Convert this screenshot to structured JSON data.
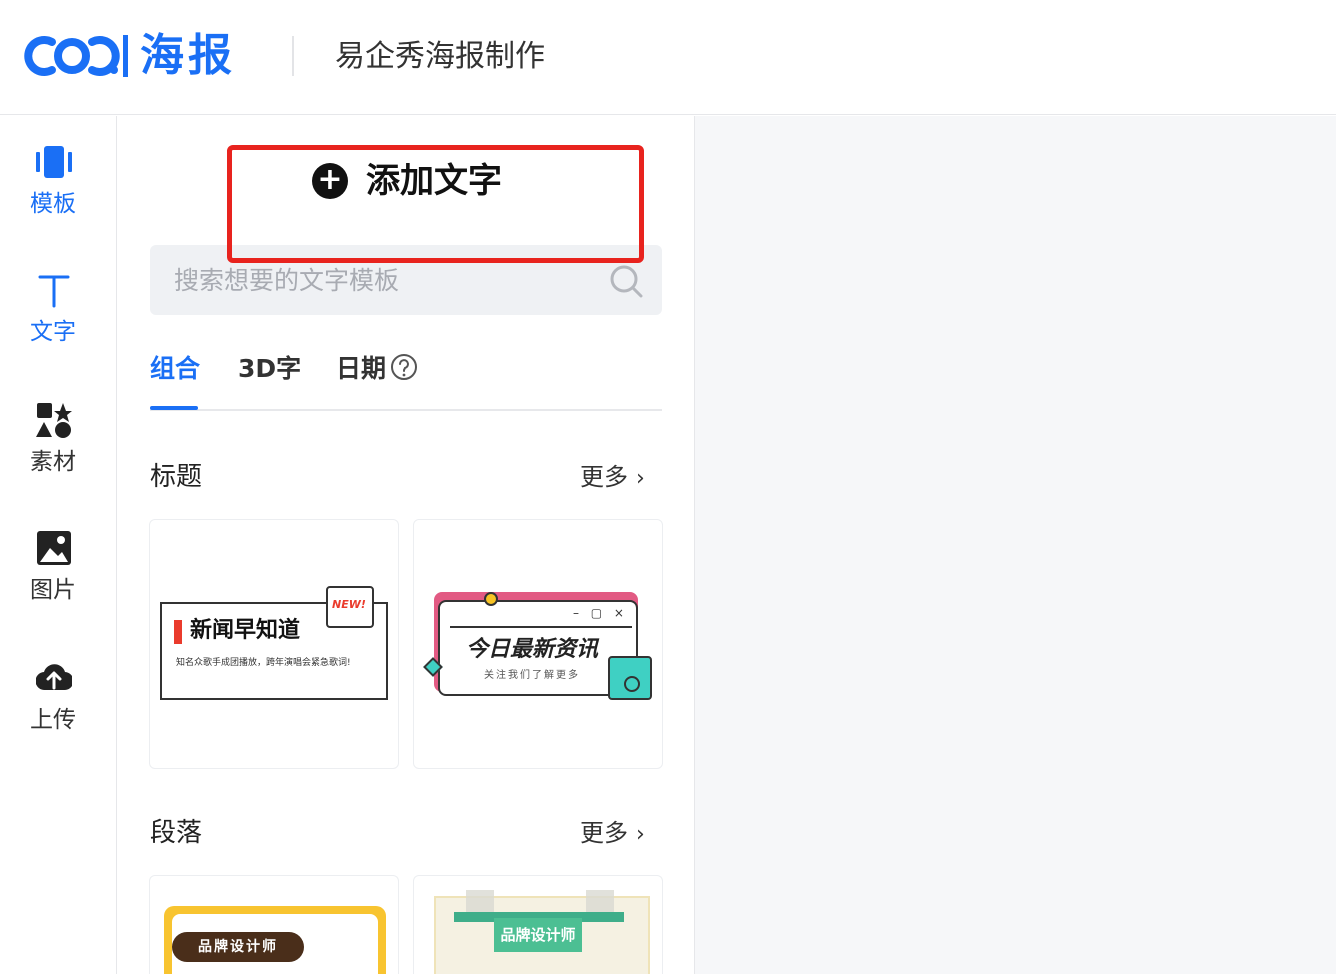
{
  "header": {
    "logo_text": "海报",
    "title": "易企秀海报制作"
  },
  "nav": {
    "items": [
      {
        "label": "模板",
        "icon": "template-icon",
        "active": true
      },
      {
        "label": "文字",
        "icon": "text-icon",
        "active": false
      },
      {
        "label": "素材",
        "icon": "shapes-icon",
        "active": false
      },
      {
        "label": "图片",
        "icon": "image-icon",
        "active": false
      },
      {
        "label": "上传",
        "icon": "upload-icon",
        "active": false
      }
    ]
  },
  "panel": {
    "add_text_label": "添加文字",
    "search_placeholder": "搜索想要的文字模板",
    "tabs": [
      {
        "label": "组合",
        "active": true
      },
      {
        "label": "3D字",
        "active": false
      },
      {
        "label": "日期",
        "active": false
      }
    ],
    "sections": [
      {
        "title": "标题",
        "more": "更多",
        "cards": [
          {
            "title": "新闻早知道",
            "sub": "知名众歌手成团播放，跨年演唱会紧急歌词!",
            "badge": "NEW!"
          },
          {
            "title": "今日最新资讯",
            "sub": "关注我们了解更多"
          }
        ]
      },
      {
        "title": "段落",
        "more": "更多",
        "cards": [
          {
            "title": "品牌设计师"
          },
          {
            "title": "品牌设计师"
          }
        ]
      }
    ]
  },
  "colors": {
    "accent": "#1a6ff5",
    "highlight": "#e8231e"
  }
}
